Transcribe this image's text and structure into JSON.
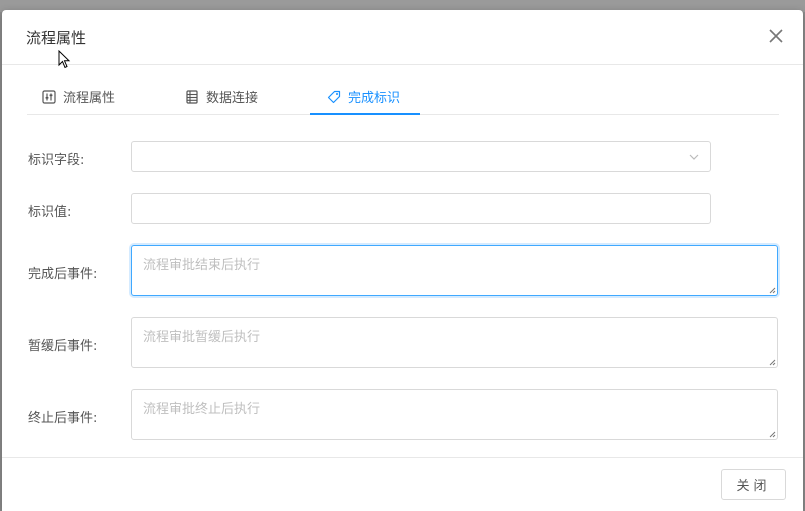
{
  "dialog": {
    "title": "流程属性",
    "close_icon": "close-icon"
  },
  "tabs": [
    {
      "label": "流程属性",
      "icon": "sliders-icon",
      "active": false
    },
    {
      "label": "数据连接",
      "icon": "database-table-icon",
      "active": false
    },
    {
      "label": "完成标识",
      "icon": "tag-icon",
      "active": true
    }
  ],
  "form": {
    "id_field": {
      "label": "标识字段:",
      "value": ""
    },
    "id_value": {
      "label": "标识值:",
      "value": ""
    },
    "on_complete": {
      "label": "完成后事件:",
      "placeholder": "流程审批结束后执行"
    },
    "on_pause": {
      "label": "暂缓后事件:",
      "placeholder": "流程审批暂缓后执行"
    },
    "on_terminate": {
      "label": "终止后事件:",
      "placeholder": "流程审批终止后执行"
    }
  },
  "footer": {
    "close_label": "关闭"
  },
  "colors": {
    "accent": "#1890ff",
    "border": "#d9d9d9",
    "focus_border": "#40a9ff"
  }
}
